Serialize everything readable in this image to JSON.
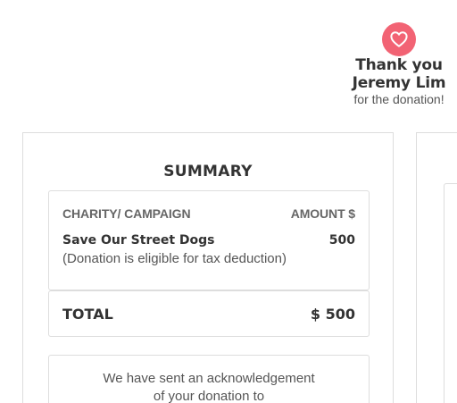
{
  "colors": {
    "heart_badge": "#f26374",
    "border": "#dddddd",
    "text_dark": "#333333",
    "text_muted": "#555555"
  },
  "header": {
    "icon": "heart-icon",
    "thank_you": "Thank you",
    "donor_name": "Jeremy Lim",
    "subtitle": "for the donation!"
  },
  "summary": {
    "title": "SUMMARY",
    "columns": {
      "campaign": "CHARITY/ CAMPAIGN",
      "amount": "AMOUNT $"
    },
    "items": [
      {
        "name": "Save Our Street Dogs",
        "amount": "500",
        "note": "(Donation is eligible for tax deduction)"
      }
    ],
    "total": {
      "label": "TOTAL",
      "value": "$ 500"
    },
    "acknowledgement": {
      "line1": "We have sent an acknowledgement",
      "line2": "of your donation to"
    }
  }
}
